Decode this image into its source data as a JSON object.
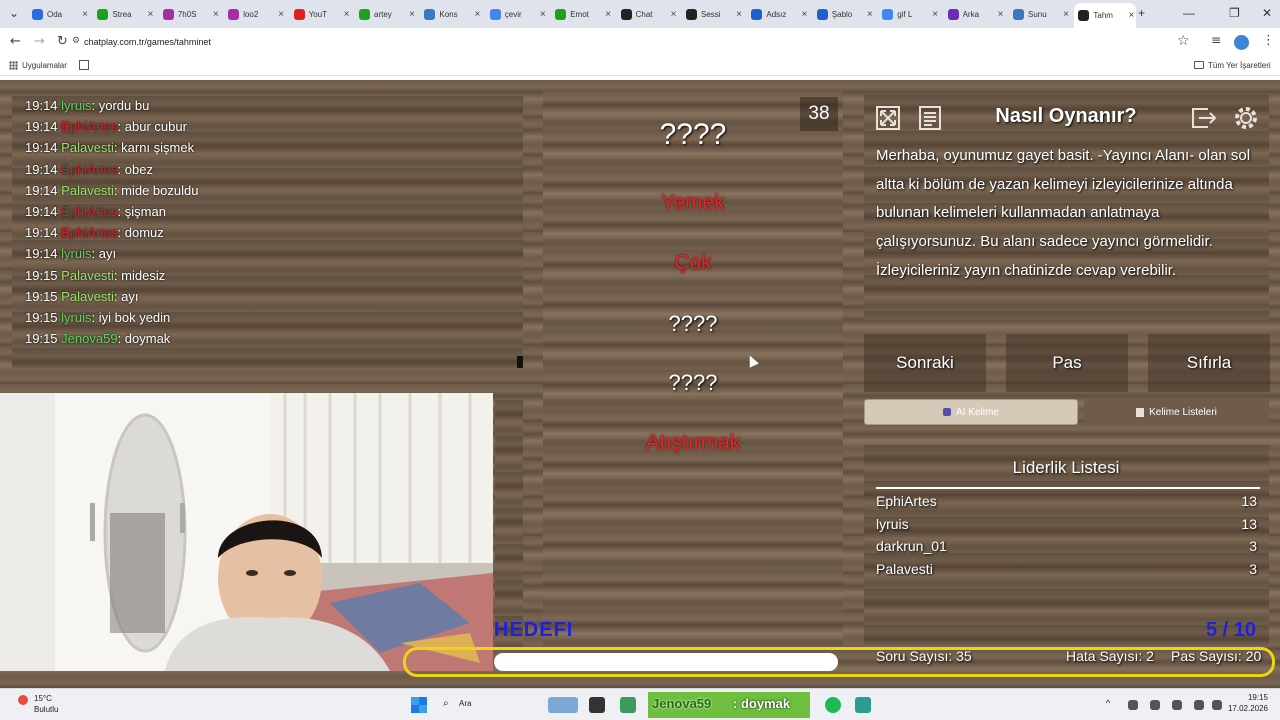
{
  "browser": {
    "tabs": [
      {
        "label": "Oda",
        "color": "#2b6de0"
      },
      {
        "label": "Strea",
        "color": "#1aa31a"
      },
      {
        "label": "7h0S",
        "color": "#a52ea5"
      },
      {
        "label": "loo2",
        "color": "#a52ea5"
      },
      {
        "label": "YouT",
        "color": "#e02020"
      },
      {
        "label": "artey",
        "color": "#1aa31a"
      },
      {
        "label": "Kons",
        "color": "#3a78c4"
      },
      {
        "label": "çevir",
        "color": "#4285f4"
      },
      {
        "label": "Emot",
        "color": "#1aa31a"
      },
      {
        "label": "Chat",
        "color": "#222222"
      },
      {
        "label": "Sessi",
        "color": "#222222"
      },
      {
        "label": "Adsız",
        "color": "#1e5fd0"
      },
      {
        "label": "Şablo",
        "color": "#1e5fd0"
      },
      {
        "label": "gif L",
        "color": "#4285f4"
      },
      {
        "label": "Arka",
        "color": "#6a2fb0"
      },
      {
        "label": "Sunu",
        "color": "#3a78c4"
      },
      {
        "label": "Tahm",
        "color": "#222222"
      }
    ],
    "url": "chatplay.com.tr/games/tahminet",
    "bookmarks": {
      "apps": "Uygulamalar",
      "all": "Tüm Yer İşaretleri"
    }
  },
  "chat": {
    "lines": [
      {
        "time": "19:14",
        "user": "lyruis",
        "color": "#5fd45f",
        "msg": ": yordu bu"
      },
      {
        "time": "19:14",
        "user": "EphiArtes",
        "color": "#d0202a",
        "msg": ": abur cubur"
      },
      {
        "time": "19:14",
        "user": "Palavesti",
        "color": "#9be56a",
        "msg": ": karnı şişmek"
      },
      {
        "time": "19:14",
        "user": "EphiArtes",
        "color": "#d0202a",
        "msg": ": obez"
      },
      {
        "time": "19:14",
        "user": "Palavesti",
        "color": "#9be56a",
        "msg": ": mide bozuldu"
      },
      {
        "time": "19:14",
        "user": "EphiArtes",
        "color": "#d0202a",
        "msg": ": şişman"
      },
      {
        "time": "19:14",
        "user": "EphiArtes",
        "color": "#d0202a",
        "msg": ": domuz"
      },
      {
        "time": "19:14",
        "user": "lyruis",
        "color": "#5fd45f",
        "msg": ": ayı"
      },
      {
        "time": "19:15",
        "user": "Palavesti",
        "color": "#9be56a",
        "msg": ": midesiz"
      },
      {
        "time": "19:15",
        "user": "Palavesti",
        "color": "#9be56a",
        "msg": ": ayı"
      },
      {
        "time": "19:15",
        "user": "lyruis",
        "color": "#5fd45f",
        "msg": ": iyi bok yedin"
      },
      {
        "time": "19:15",
        "user": "Jenova59",
        "color": "#5fd45f",
        "msg": ": doymak"
      }
    ]
  },
  "game": {
    "timer": "38",
    "words": [
      {
        "text": "????",
        "taboo": false
      },
      {
        "text": "Yemek",
        "taboo": true
      },
      {
        "text": "Çok",
        "taboo": true
      },
      {
        "text": "????",
        "taboo": false
      },
      {
        "text": "????",
        "taboo": false
      },
      {
        "text": "Atıştırmak",
        "taboo": true
      }
    ],
    "target_label": "HEDEFI",
    "goal": "5 / 10",
    "goal_progress": 0.5
  },
  "help": {
    "title": "Nasıl Oynanır?",
    "text": "Merhaba, oyunumuz gayet basit. -Yayıncı Alanı- olan sol altta ki bölüm de yazan kelimeyi izleyicilerinize altında bulunan kelimeleri kullanmadan anlatmaya çalışıyorsunuz. Bu alanı sadece yayıncı görmelidir. İzleyicileriniz yayın chatinizde cevap verebilir."
  },
  "controls": {
    "next": "Sonraki",
    "pass": "Pas",
    "reset": "Sıfırla",
    "ai": "AI Kelime",
    "lists": "Kelime Listeleri"
  },
  "leaderboard": {
    "title": "Liderlik Listesi",
    "rows": [
      {
        "name": "EphiArtes",
        "score": "13"
      },
      {
        "name": "lyruis",
        "score": "13"
      },
      {
        "name": "darkrun_01",
        "score": "3"
      },
      {
        "name": "Palavesti",
        "score": "3"
      }
    ]
  },
  "stats": {
    "questions": "Soru Sayısı: 35",
    "errors": "Hata Sayısı: 2",
    "passes": "Pas Sayısı: 20"
  },
  "taskbar": {
    "weather_temp": "15°C",
    "weather_text": "Bulutlu",
    "search": "Ara",
    "overlay_user": "Jenova59",
    "overlay_msg": ": doymak",
    "time": "19:15",
    "date": "17.02.2026"
  },
  "colors": {
    "taboo": "#e0262a",
    "highlight": "#ecd60d",
    "target": "#2020d8"
  }
}
